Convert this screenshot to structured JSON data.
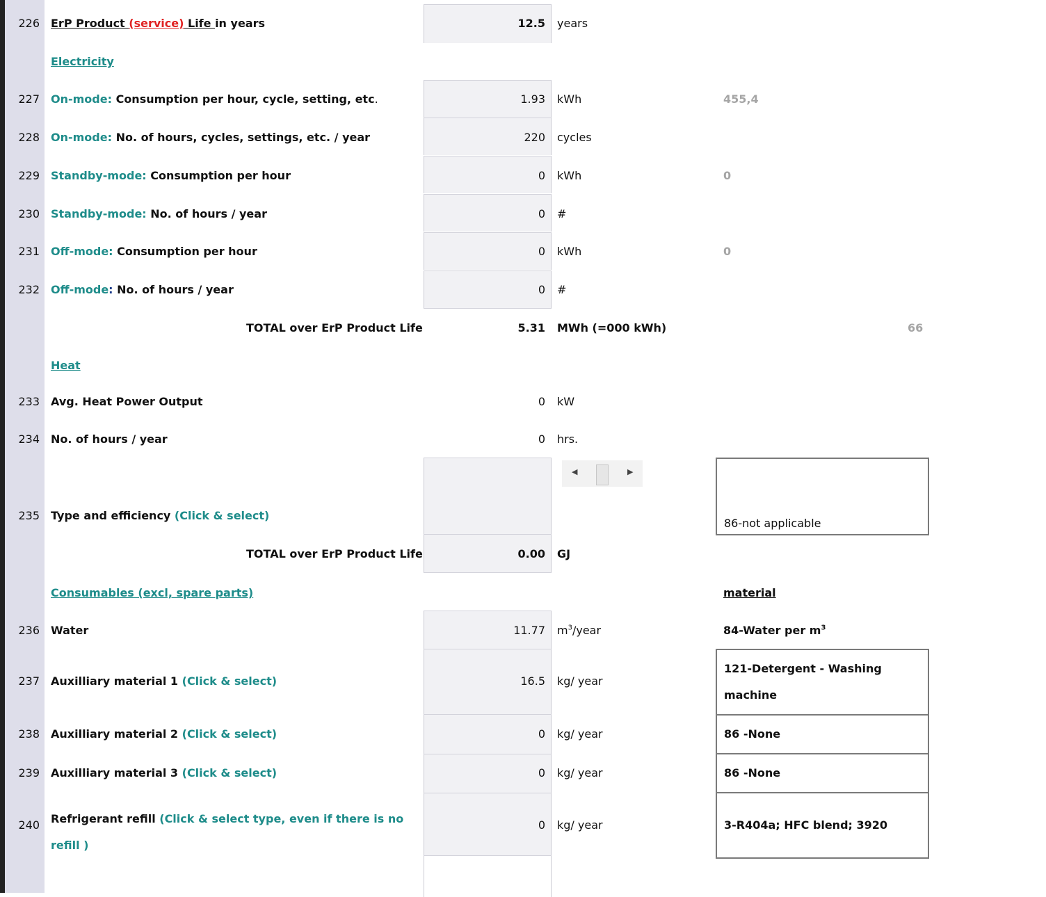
{
  "rows": {
    "r226": {
      "num": "226",
      "label_pre": "ErP Product ",
      "label_red": "(service)",
      "label_mid": " Life ",
      "label_post": "in years",
      "value": "12.5",
      "unit": "years"
    },
    "electricity_header": "Electricity",
    "r227": {
      "num": "227",
      "prefix": "On-mode:",
      "text": " Consumption per hour, cycle, setting, etc",
      "tail": ".",
      "value": "1.93",
      "unit": "kWh",
      "extra": "455,4"
    },
    "r228": {
      "num": "228",
      "prefix": "On-mode:",
      "text": " No. of hours, cycles, settings, etc. / year",
      "value": "220",
      "unit": "cycles"
    },
    "r229": {
      "num": "229",
      "prefix": "Standby-mode:",
      "text": " Consumption per hour",
      "value": "0",
      "unit": "kWh",
      "extra": "0"
    },
    "r230": {
      "num": "230",
      "prefix": "Standby-mode:",
      "text": " No. of hours / year",
      "value": "0",
      "unit": "#"
    },
    "r231": {
      "num": "231",
      "prefix": "Off-mode:",
      "text": " Consumption per hour",
      "value": "0",
      "unit": "kWh",
      "extra": "0"
    },
    "r232": {
      "num": "232",
      "prefix": "Off-mode",
      "colon": ":",
      "text": " No. of hours / year",
      "value": "0",
      "unit": "#"
    },
    "total_elec": {
      "label": "TOTAL over ErP Product Life",
      "value": "5.31",
      "unit": "MWh (=000 kWh)",
      "extra": "66"
    },
    "heat_header": "Heat",
    "r233": {
      "num": "233",
      "text": "Avg. Heat Power Output",
      "value": "0",
      "unit": "kW"
    },
    "r234": {
      "num": "234",
      "text": "No. of hours / year",
      "value": "0",
      "unit": "hrs."
    },
    "r235": {
      "num": "235",
      "text": "Type and efficiency ",
      "hint": "(Click & select)",
      "box": "86-not applicable"
    },
    "total_heat": {
      "label": "TOTAL over ErP Product Life",
      "value": "0.00",
      "unit": "GJ"
    },
    "consumables_header": "Consumables (excl, spare parts)",
    "material_header": "material",
    "r236": {
      "num": "236",
      "text": "Water",
      "value": "11.77",
      "unit_pre": "m",
      "unit_sup": "3",
      "unit_post": "/year",
      "mat_pre": "84-Water per m",
      "mat_sup": "3"
    },
    "r237": {
      "num": "237",
      "text": "Auxilliary material 1 ",
      "hint": "(Click & select)",
      "value": "16.5",
      "unit": "kg/ year",
      "mat_line1": "121-Detergent - Washing",
      "mat_line2": "machine"
    },
    "r238": {
      "num": "238",
      "text": "Auxilliary material 2 ",
      "hint": "(Click & select)",
      "value": "0",
      "unit": "kg/ year",
      "mat": "86 -None"
    },
    "r239": {
      "num": "239",
      "text": "Auxilliary material 3 ",
      "hint": "(Click & select)",
      "value": "0",
      "unit": "kg/ year",
      "mat": "86 -None"
    },
    "r240": {
      "num": "240",
      "text": "Refrigerant refill ",
      "hint_line1": "(Click & select type, even if there is no",
      "hint_line2": "refill )",
      "value": "0",
      "unit": "kg/ year",
      "mat": "3-R404a; HFC blend; 3920"
    }
  },
  "scrollbar": {
    "left_arrow": "◀",
    "right_arrow": "▶"
  }
}
